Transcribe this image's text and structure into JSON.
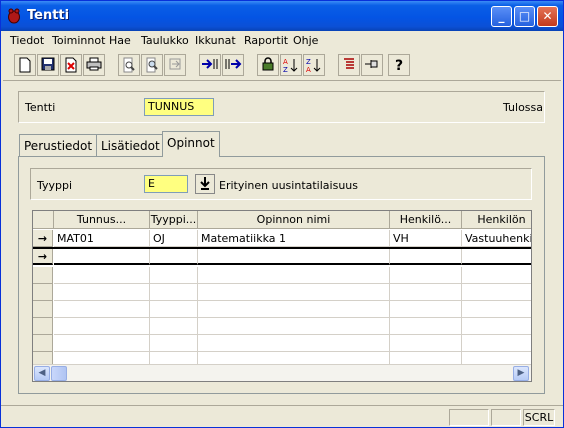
{
  "window": {
    "title": "Tentti",
    "minimize_label": "_",
    "maximize_label": "□",
    "close_label": "✕"
  },
  "menu": [
    "Tiedot",
    "Toiminnot",
    "Hae",
    "Taulukko",
    "Ikkunat",
    "Raportit",
    "Ohje"
  ],
  "toolbar": {
    "icons": [
      "new-document-icon",
      "save-icon",
      "delete-icon",
      "print-icon",
      "print-preview-icon",
      "search-icon",
      "exit-icon",
      "import-icon",
      "export-icon",
      "lock-icon",
      "sort-ascending-icon",
      "sort-descending-icon",
      "list-icon",
      "pin-icon",
      "help-icon"
    ]
  },
  "header": {
    "label": "Tentti",
    "value": "TUNNUS",
    "status": "Tulossa"
  },
  "tabs": [
    "Perustiedot",
    "Lisätiedot",
    "Opinnot"
  ],
  "active_tab": "Opinnot",
  "type_field": {
    "label": "Tyyppi",
    "value": "E",
    "description": "Erityinen uusintatilaisuus"
  },
  "table": {
    "columns": [
      "Tunnus...",
      "Tyyppi...",
      "Opinnon nimi",
      "Henkilö...",
      "Henkilön"
    ],
    "rows": [
      {
        "indicator": "→",
        "cells": [
          "MAT01",
          "OJ",
          "Matematiikka 1",
          "VH",
          "Vastuuhenkilö"
        ]
      },
      {
        "indicator": "→",
        "cells": [
          "",
          "",
          "",
          "",
          ""
        ]
      }
    ],
    "empty_rows": 6
  },
  "status": {
    "panes": [
      "",
      "",
      "SCRL"
    ]
  }
}
